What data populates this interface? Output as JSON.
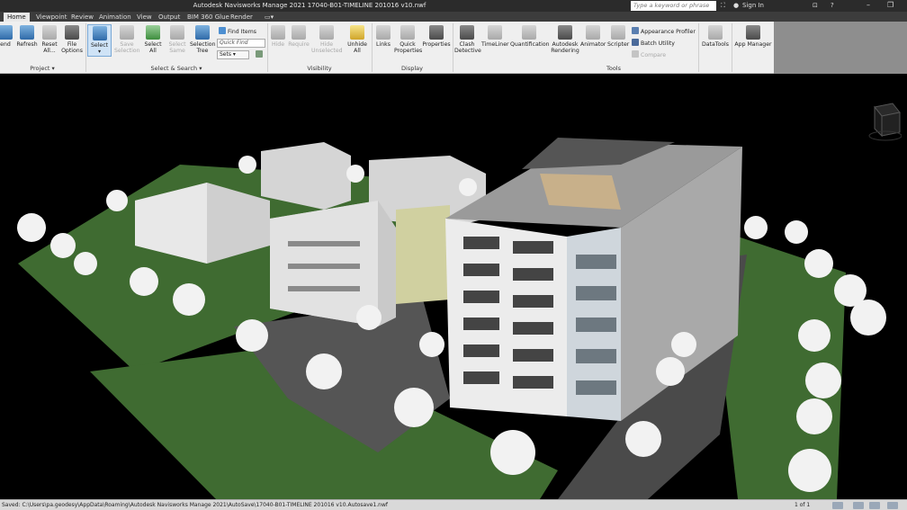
{
  "window": {
    "title": "Autodesk Navisworks Manage 2021     17040-B01-TIMELINE 201016 v10.nwf",
    "search_placeholder": "Type a keyword or phrase",
    "sign_in": "Sign In"
  },
  "tabs": [
    "Home",
    "Viewpoint",
    "Review",
    "Animation",
    "View",
    "Output",
    "BIM 360 Glue",
    "Render"
  ],
  "ribbon": {
    "project": {
      "label": "Project",
      "append": "end",
      "refresh": "Refresh",
      "reset_all": [
        "Reset",
        "All..."
      ],
      "file_options": [
        "File",
        "Options"
      ]
    },
    "select_search": {
      "label": "Select & Search",
      "select": "Select",
      "save_selection": [
        "Save",
        "Selection"
      ],
      "select_all": [
        "Select",
        "All"
      ],
      "select_same": [
        "Select",
        "Same"
      ],
      "selection_tree": [
        "Selection",
        "Tree"
      ],
      "find_items": "Find Items",
      "quick_find_placeholder": "Quick Find",
      "sets": "Sets"
    },
    "visibility": {
      "label": "Visibility",
      "hide": "Hide",
      "require": "Require",
      "hide_unselected": [
        "Hide",
        "Unselected"
      ],
      "unhide_all": [
        "Unhide",
        "All"
      ]
    },
    "display": {
      "label": "Display",
      "links": "Links",
      "quick_properties": [
        "Quick",
        "Properties"
      ],
      "properties": "Properties"
    },
    "tools": {
      "label": "Tools",
      "clash_detective": [
        "Clash",
        "Detective"
      ],
      "timeliner": "TimeLiner",
      "quantification": "Quantification",
      "autodesk_rendering": [
        "Autodesk",
        "Rendering"
      ],
      "animator": "Animator",
      "scripter": "Scripter",
      "appearance_profiler": "Appearance Profiler",
      "batch_utility": "Batch Utility",
      "compare": "Compare"
    },
    "datatools": "DataTools",
    "app_manager": "App Manager"
  },
  "statusbar": {
    "path": "Saved: C:\\Users\\pa.geodesy\\AppData\\Roaming\\Autodesk Navisworks Manage 2021\\AutoSave\\17040-B01-TIMELINE 201016 v10.Autosave1.nwf",
    "page": "1 of 1"
  },
  "colors": {
    "accent": "#79a8d6",
    "ground": "#3f6b31",
    "building": "#e6e6e6"
  }
}
